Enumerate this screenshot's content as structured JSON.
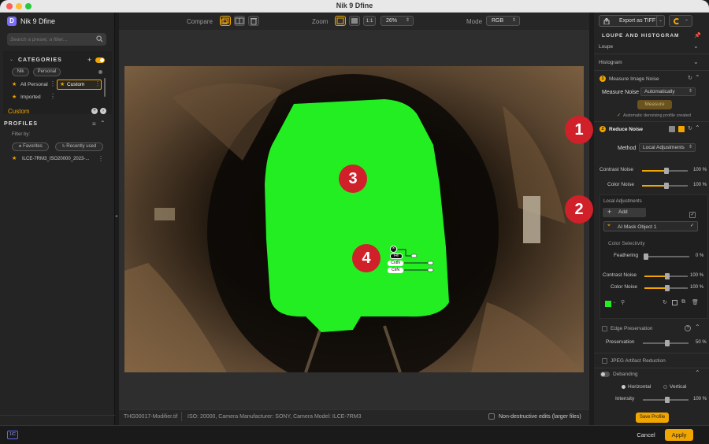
{
  "window": {
    "title": "Nik 9 Dfine"
  },
  "sidebar": {
    "app_name": "Nik 9 Dfine",
    "search_placeholder": "Search a preset, a filter...",
    "categories_header": "CATEGORIES",
    "category_tabs": [
      "Nik",
      "Personal"
    ],
    "presets": [
      "All Personal",
      "Custom",
      "Imported"
    ],
    "custom_label": "Custom",
    "profiles_header": "PROFILES",
    "filter_by": "Filter by:",
    "filter_pills": [
      "Favorites",
      "Recently used"
    ],
    "profile_item": "ILCE-7RM3_ISO20000_2023-..."
  },
  "toolbar": {
    "compare_label": "Compare",
    "zoom_label": "Zoom",
    "zoom_ratio": "1:1",
    "zoom_value": "26%",
    "mode_label": "Mode",
    "mode_value": "RGB",
    "export_label": "Export as TIFF"
  },
  "canvas": {
    "badges": [
      "3",
      "4"
    ],
    "node_labels": [
      "Fe",
      "CntN",
      "ClrN"
    ]
  },
  "status": {
    "filename": "THG00017-Modifier.tif",
    "meta": "ISO: 20000, Camera Manufacturer: SONY, Camera Model: ILCE-7RM3",
    "nondestructive": "Non-destructive edits (larger files)"
  },
  "panel": {
    "loupe_header": "LOUPE AND HISTOGRAM",
    "loupe": "Loupe",
    "histogram": "Histogram",
    "step1": "1",
    "measure_title": "Measure Image Noise",
    "measure_noise_label": "Measure Noise",
    "measure_noise_value": "Automatically",
    "measure_button": "Measure",
    "auto_profile": "Automatic denoising profile created",
    "step2": "2",
    "reduce_title": "Reduce Noise",
    "method_label": "Method",
    "method_value": "Local Adjustments",
    "contrast_noise": "Contrast Noise",
    "contrast_noise_val": "100 %",
    "color_noise": "Color Noise",
    "color_noise_val": "100 %",
    "local_adj": "Local Adjustments",
    "add_label": "Add",
    "mask_name": "AI Mask Object 1",
    "color_selectivity": "Color Selectivity",
    "feathering": "Feathering",
    "feathering_val": "0 %",
    "la_contrast": "Contrast Noise",
    "la_contrast_val": "100 %",
    "la_color": "Color Noise",
    "la_color_val": "100 %",
    "edge_preservation": "Edge Preservation",
    "preservation": "Preservation",
    "preservation_val": "50 %",
    "jpeg_artifact": "JPEG Artifact Reduction",
    "debanding": "Debanding",
    "horizontal": "Horizontal",
    "vertical": "Vertical",
    "intensity": "Intensity",
    "intensity_val": "100 %",
    "save_profile": "Save Profile",
    "badges": [
      "1",
      "2"
    ]
  },
  "footer": {
    "cancel": "Cancel",
    "apply": "Apply"
  },
  "colors": {
    "accent": "#f0a500",
    "mask": "#22ee22",
    "badge": "#d0202a"
  }
}
